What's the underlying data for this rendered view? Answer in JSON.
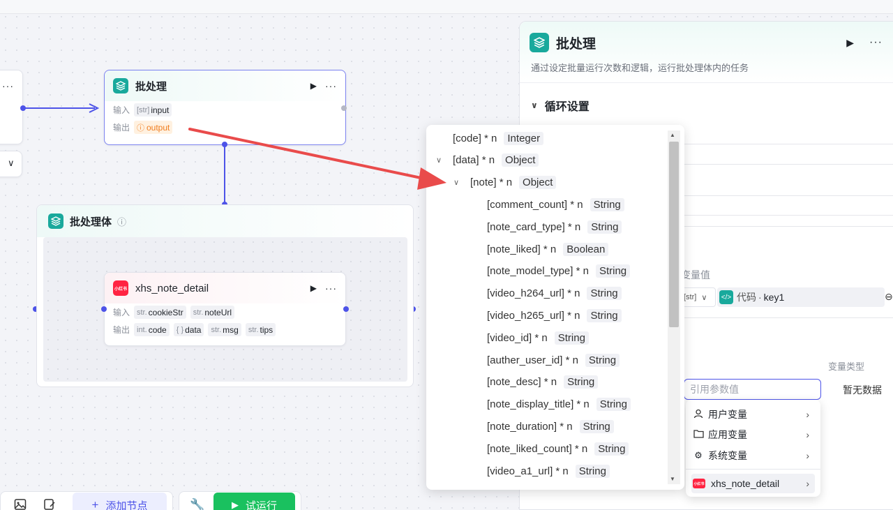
{
  "colors": {
    "accent": "#4d53e8",
    "teal": "#19a99c",
    "arrow": "#e94b4b",
    "run": "#1ac15f"
  },
  "left_partial_node": {
    "more": "···",
    "chevron": "∨"
  },
  "batch_node": {
    "title": "批处理",
    "input_label": "输入",
    "input_tag_type": "[str]",
    "input_tag_name": "input",
    "output_label": "输出",
    "output_tag_icon": "ⓘ",
    "output_tag_name": "output"
  },
  "batch_body": {
    "title": "批处理体",
    "info_icon": "ⓘ"
  },
  "xhs_node": {
    "icon_text": "小红书",
    "title": "xhs_note_detail",
    "input_label": "输入",
    "inputs": [
      {
        "type": "str.",
        "name": "cookieStr"
      },
      {
        "type": "str.",
        "name": "noteUrl"
      }
    ],
    "output_label": "输出",
    "outputs": [
      {
        "type": "int.",
        "name": "code"
      },
      {
        "type": "{ }",
        "name": "data"
      },
      {
        "type": "str.",
        "name": "msg"
      },
      {
        "type": "str.",
        "name": "tips"
      }
    ]
  },
  "panel": {
    "title": "批处理",
    "description": "通过设定批量运行次数和逻辑，运行批处理体内的任务",
    "section_loop": "循环设置",
    "var_value_label": "变量值",
    "var_select_type": "[str]",
    "code_ref": "代码",
    "code_ref_key": "key1",
    "var_type_label": "变量类型",
    "ref_placeholder": "引用参数值",
    "no_data": "暂无数据"
  },
  "tree": [
    {
      "label": "[code] * n",
      "type": "Integer",
      "indent": 0,
      "expanded": null
    },
    {
      "label": "[data] * n",
      "type": "Object",
      "indent": 0,
      "expanded": true
    },
    {
      "label": "[note] * n",
      "type": "Object",
      "indent": 1,
      "expanded": true
    },
    {
      "label": "[comment_count] * n",
      "type": "String",
      "indent": 2
    },
    {
      "label": "[note_card_type] * n",
      "type": "String",
      "indent": 2
    },
    {
      "label": "[note_liked] * n",
      "type": "Boolean",
      "indent": 2
    },
    {
      "label": "[note_model_type] * n",
      "type": "String",
      "indent": 2
    },
    {
      "label": "[video_h264_url] * n",
      "type": "String",
      "indent": 2
    },
    {
      "label": "[video_h265_url] * n",
      "type": "String",
      "indent": 2
    },
    {
      "label": "[video_id] * n",
      "type": "String",
      "indent": 2
    },
    {
      "label": "[auther_user_id] * n",
      "type": "String",
      "indent": 2
    },
    {
      "label": "[note_desc] * n",
      "type": "String",
      "indent": 2
    },
    {
      "label": "[note_display_title] * n",
      "type": "String",
      "indent": 2
    },
    {
      "label": "[note_duration] * n",
      "type": "String",
      "indent": 2
    },
    {
      "label": "[note_liked_count] * n",
      "type": "String",
      "indent": 2
    },
    {
      "label": "[video_a1_url] * n",
      "type": "String",
      "indent": 2
    }
  ],
  "submenu": {
    "items": [
      {
        "label": "用户变量",
        "icon": "user-icon"
      },
      {
        "label": "应用变量",
        "icon": "folder-icon"
      },
      {
        "label": "系统变量",
        "icon": "gear-icon"
      }
    ],
    "xhs_icon_text": "小红书",
    "xhs_label": "xhs_note_detail"
  },
  "toolbar": {
    "add_node": "添加节点",
    "run": "试运行"
  }
}
